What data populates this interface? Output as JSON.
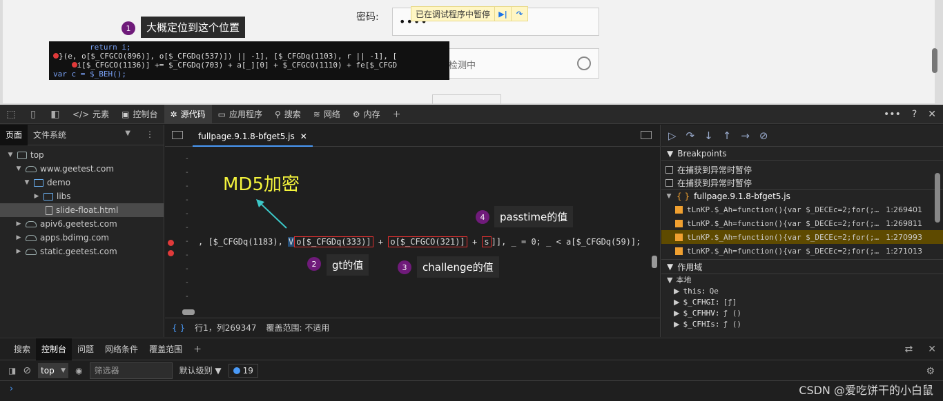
{
  "preview": {
    "password_label": "密码:",
    "password_dots": "••••",
    "paused_text": "已在调试程序中暂停",
    "captcha_text": "检测中"
  },
  "tooltip": {
    "line1": "return i;",
    "line2": "}(e, o[$_CFGCO(896)], o[$_CFGDq(537)]) || -1], [$_CFGDq(1103), r || -1], [",
    "line3": "i[$_CFGCO(1136)] += $_CFGDq(703) + a[_][0] + $_CFGCO(1110) + fe[$_CFGD",
    "line4": "var c = $_BEH();"
  },
  "annotations": [
    {
      "num": "1",
      "text": "大概定位到这个位置"
    },
    {
      "num": "2",
      "text": "gt的值"
    },
    {
      "num": "3",
      "text": "challenge的值"
    },
    {
      "num": "4",
      "text": "passtime的值"
    }
  ],
  "md5_label": "MD5加密",
  "toolbar": {
    "tabs": [
      "元素",
      "控制台",
      "源代码",
      "应用程序",
      "搜索",
      "网络",
      "内存"
    ],
    "active": "源代码"
  },
  "navigator": {
    "tabs": [
      "页面",
      "文件系统"
    ],
    "tree": [
      "top",
      "www.geetest.com",
      "demo",
      "libs",
      "slide-float.html",
      "apiv6.geetest.com",
      "apps.bdimg.com",
      "static.geetest.com"
    ]
  },
  "editor": {
    "tab_name": "fullpage.9.1.8-bfget5.js",
    "code": {
      "pre": ", [$_CFGDq(1183), ",
      "v": "V",
      "gt": "o[$_CFGDq(333)]",
      "plus1": " + ",
      "challenge": "o[$_CFGCO(321)]",
      "plus2": " + ",
      "s": "s",
      "post": "]], _ = 0; _ < a[$_CFGDq(59)];"
    },
    "status_braces": "{ }",
    "status_pos": "行1，列269347",
    "status_coverage": "覆盖范围: 不适用"
  },
  "debugger": {
    "breakpoints_header": "Breakpoints",
    "pause_options": [
      "在捕获到异常时暂停",
      "在捕获到异常时暂停"
    ],
    "file": "fullpage.9.1.8-bfget5.js",
    "bps": [
      {
        "code": "tLnKP.$_Ah=function(){var $_DECEc=2;for(;…",
        "line": "1:269401"
      },
      {
        "code": "tLnKP.$_Ah=function(){var $_DECEc=2;for(;…",
        "line": "1:269811"
      },
      {
        "code": "tLnKP.$_Ah=function(){var $_DECEc=2;for(;…",
        "line": "1:270993"
      },
      {
        "code": "tLnKP.$_Ah=function(){var $_DECEc=2;for(;…",
        "line": "1:271013"
      }
    ],
    "scope_header": "作用域",
    "local_header": "本地",
    "scope": [
      {
        "k": "this:",
        "v": "Qe"
      },
      {
        "k": "$_CFHGI:",
        "v": "[ƒ]"
      },
      {
        "k": "$_CFHHV:",
        "v": "ƒ ()"
      },
      {
        "k": "$_CFHIs:",
        "v": "ƒ ()"
      }
    ]
  },
  "drawer": {
    "tabs": [
      "搜索",
      "控制台",
      "问题",
      "网络条件",
      "覆盖范围"
    ],
    "active": "控制台",
    "context": "top",
    "filter_placeholder": "筛选器",
    "level": "默认级别",
    "issues_count": "19",
    "watermark": "CSDN @爱吃饼干的小白鼠"
  },
  "colors": {
    "accent": "#4a9af8",
    "badge": "#6f1b7a",
    "md5": "#f3f33c",
    "highlight": "#e03030"
  }
}
